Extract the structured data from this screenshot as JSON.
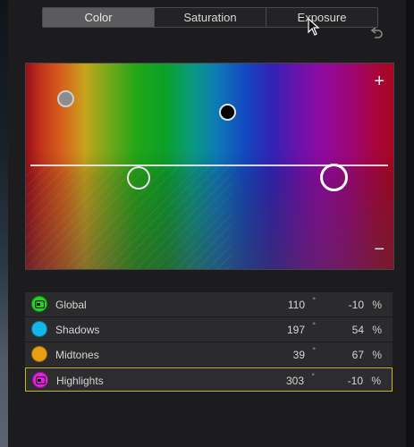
{
  "tabs": [
    {
      "label": "Color",
      "active": true
    },
    {
      "label": "Saturation",
      "active": false
    },
    {
      "label": "Exposure",
      "active": false
    }
  ],
  "icons": {
    "undo": "undo-icon",
    "plus": "+",
    "minus": "−"
  },
  "symbols": {
    "degree": "°",
    "percent": "%"
  },
  "rows": [
    {
      "label": "Global",
      "hue": "110",
      "amount": "-10",
      "color": "#1fd81f",
      "selected": false
    },
    {
      "label": "Shadows",
      "hue": "197",
      "amount": "54",
      "color": "#16b6e8",
      "selected": false
    },
    {
      "label": "Midtones",
      "hue": "39",
      "amount": "67",
      "color": "#e8a012",
      "selected": false
    },
    {
      "label": "Highlights",
      "hue": "303",
      "amount": "-10",
      "color": "#e81ee0",
      "selected": true
    }
  ],
  "colors": {
    "selection_border": "#c9b51f",
    "active_tab": "#5b5b5d"
  }
}
